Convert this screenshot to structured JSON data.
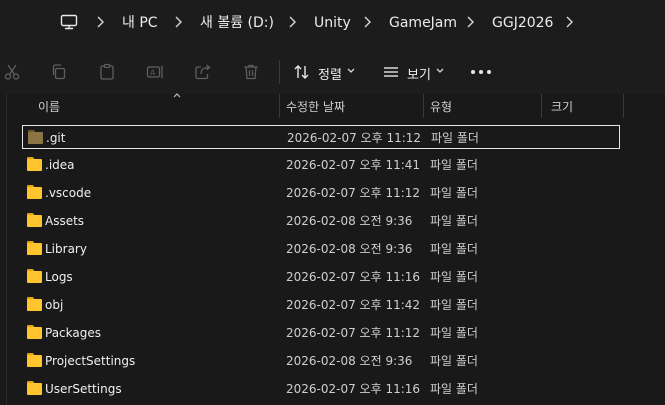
{
  "address_bar": {
    "items": [
      "내 PC",
      "새 볼륨 (D:)",
      "Unity",
      "GameJam",
      "GGJ2026"
    ]
  },
  "toolbar": {
    "sort_label": "정렬",
    "view_label": "보기"
  },
  "columns": {
    "name": "이름",
    "date": "수정한 날짜",
    "type": "유형",
    "size": "크기"
  },
  "files": [
    {
      "name": ".git",
      "date": "2026-02-07 오후 11:12",
      "type": "파일 폴더",
      "selected": true,
      "hidden": true
    },
    {
      "name": ".idea",
      "date": "2026-02-07 오후 11:41",
      "type": "파일 폴더"
    },
    {
      "name": ".vscode",
      "date": "2026-02-07 오후 11:12",
      "type": "파일 폴더"
    },
    {
      "name": "Assets",
      "date": "2026-02-08 오전 9:36",
      "type": "파일 폴더"
    },
    {
      "name": "Library",
      "date": "2026-02-08 오전 9:36",
      "type": "파일 폴더"
    },
    {
      "name": "Logs",
      "date": "2026-02-07 오후 11:16",
      "type": "파일 폴더"
    },
    {
      "name": "obj",
      "date": "2026-02-07 오후 11:42",
      "type": "파일 폴더"
    },
    {
      "name": "Packages",
      "date": "2026-02-07 오후 11:12",
      "type": "파일 폴더"
    },
    {
      "name": "ProjectSettings",
      "date": "2026-02-08 오전 9:36",
      "type": "파일 폴더"
    },
    {
      "name": "UserSettings",
      "date": "2026-02-07 오후 11:16",
      "type": "파일 폴더"
    }
  ],
  "colors": {
    "background": "#191919",
    "folder": "#ffc52e",
    "hidden_folder": "#8a7441",
    "selection_border": "#e5e5e5"
  }
}
